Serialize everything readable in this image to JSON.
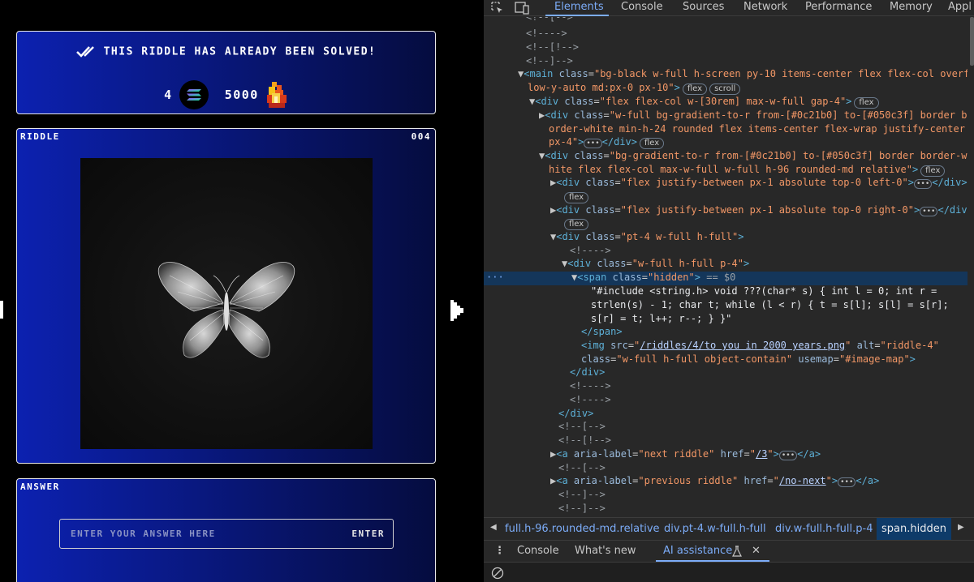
{
  "game": {
    "status_text": "THIS RIDDLE HAS ALREADY BEEN SOLVED!",
    "sol_count": "4",
    "points": "5000",
    "riddle_label": "RIDDLE",
    "riddle_number": "004",
    "answer_label": "ANSWER",
    "answer_placeholder": "ENTER YOUR ANSWER HERE",
    "enter_label": "ENTER",
    "colors": {
      "gradient_from": "#0c21b0",
      "gradient_to": "#050c3f"
    }
  },
  "devtools": {
    "tabs": [
      "Elements",
      "Console",
      "Sources",
      "Network",
      "Performance",
      "Memory",
      "Appl"
    ],
    "active_tab": "Elements",
    "dom": {
      "l0": "<!--[-->",
      "l1": "<!---->",
      "l2": "<!--[!-->",
      "l3": "<!--]-->",
      "main_tag": "main",
      "main_class": "bg-black w-full h-screen py-10 items-center flex flex-col overf",
      "main_class2": "low-y-auto md:px-0 px-10",
      "badge_flex": "flex",
      "badge_scroll": "scroll",
      "div1_class": "flex flex-col w-[30rem] max-w-full gap-4",
      "div2_class": "w-full bg-gradient-to-r from-[#0c21b0] to-[#050c3f] border b",
      "div2_class2": "order-white min-h-24 rounded flex items-center flex-wrap justify-center",
      "div2_class3": "px-4",
      "div3_class": "bg-gradient-to-r from-[#0c21b0] to-[#050c3f] border border-w",
      "div3_class2": "hite flex flex-col max-w-full w-full h-96 rounded-md relative",
      "div4_class": "flex justify-between px-1 absolute top-0 left-0",
      "div5_class": "flex justify-between px-1 absolute top-0 right-0",
      "div6_class": "pt-4 w-full h-full",
      "div7_class": "w-full h-full p-4",
      "span_class": "hidden",
      "eq_ref": "== $0",
      "code1": "\"#include <string.h> void ???(char* s) { int l = 0; int r =",
      "code2": "strlen(s) - 1; char t; while (l < r) { t = s[l]; s[l] = s[r];",
      "code3": "s[r] = t; l++; r--; } }\"",
      "img_src": "/riddles/4/to you in 2000 years.png",
      "img_alt": "riddle-4",
      "img_class": "w-full h-full object-contain",
      "img_usemap": "#image-map",
      "a1_label": "next riddle",
      "a1_href": "/3",
      "a2_label": "previous riddle",
      "a2_href": "/no-next"
    },
    "breadcrumbs": [
      "full.h-96.rounded-md.relative",
      "div.pt-4.w-full.h-full",
      "div.w-full.h-full.p-4",
      "span.hidden"
    ],
    "drawer_tabs": [
      "Console",
      "What's new",
      "AI assistance"
    ]
  }
}
